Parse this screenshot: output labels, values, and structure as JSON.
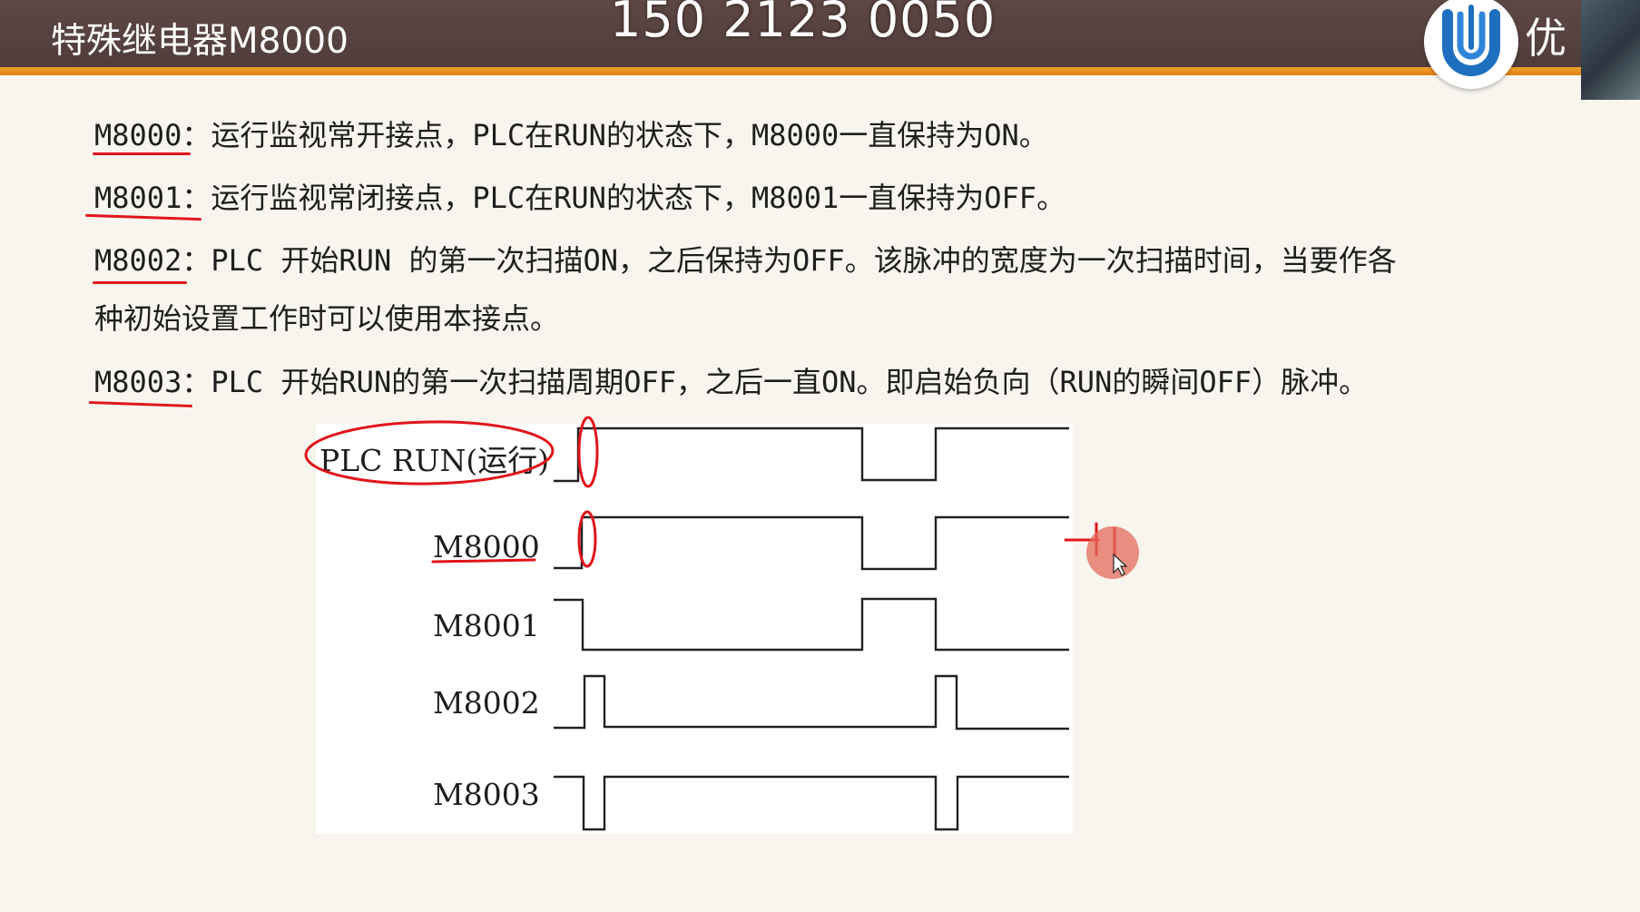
{
  "header": {
    "title": "特殊继电器M8000",
    "phone_overlay": "150 2123 0050",
    "brand_text": "优"
  },
  "paragraphs": [
    {
      "key": "M8000：",
      "text": "运行监视常开接点，PLC在RUN的状态下，M8000一直保持为ON。"
    },
    {
      "key": "M8001：",
      "text": "运行监视常闭接点，PLC在RUN的状态下，M8001一直保持为OFF。"
    },
    {
      "key": "M8002：",
      "text": "PLC 开始RUN 的第一次扫描ON，之后保持为OFF。该脉冲的宽度为一次扫描时间，当要作各",
      "continuation": "种初始设置工作时可以使用本接点。"
    },
    {
      "key": "M8003：",
      "text": "PLC 开始RUN的第一次扫描周期OFF，之后一直ON。即启始负向（RUN的瞬间OFF）脉冲。"
    }
  ],
  "diagram": {
    "signals": [
      {
        "label": "PLC  RUN(运行)"
      },
      {
        "label": "M8000"
      },
      {
        "label": "M8001"
      },
      {
        "label": "M8002"
      },
      {
        "label": "M8003"
      }
    ]
  },
  "colors": {
    "header_bg": "#553f3c",
    "header_accent": "#f0951f",
    "annotation_red": "#e0151b",
    "logo_blue": "#1f6fc0",
    "slide_bg": "#f7f5ee"
  },
  "icons": {
    "logo": "u-logo-icon",
    "cursor": "pointer-cursor-icon"
  }
}
